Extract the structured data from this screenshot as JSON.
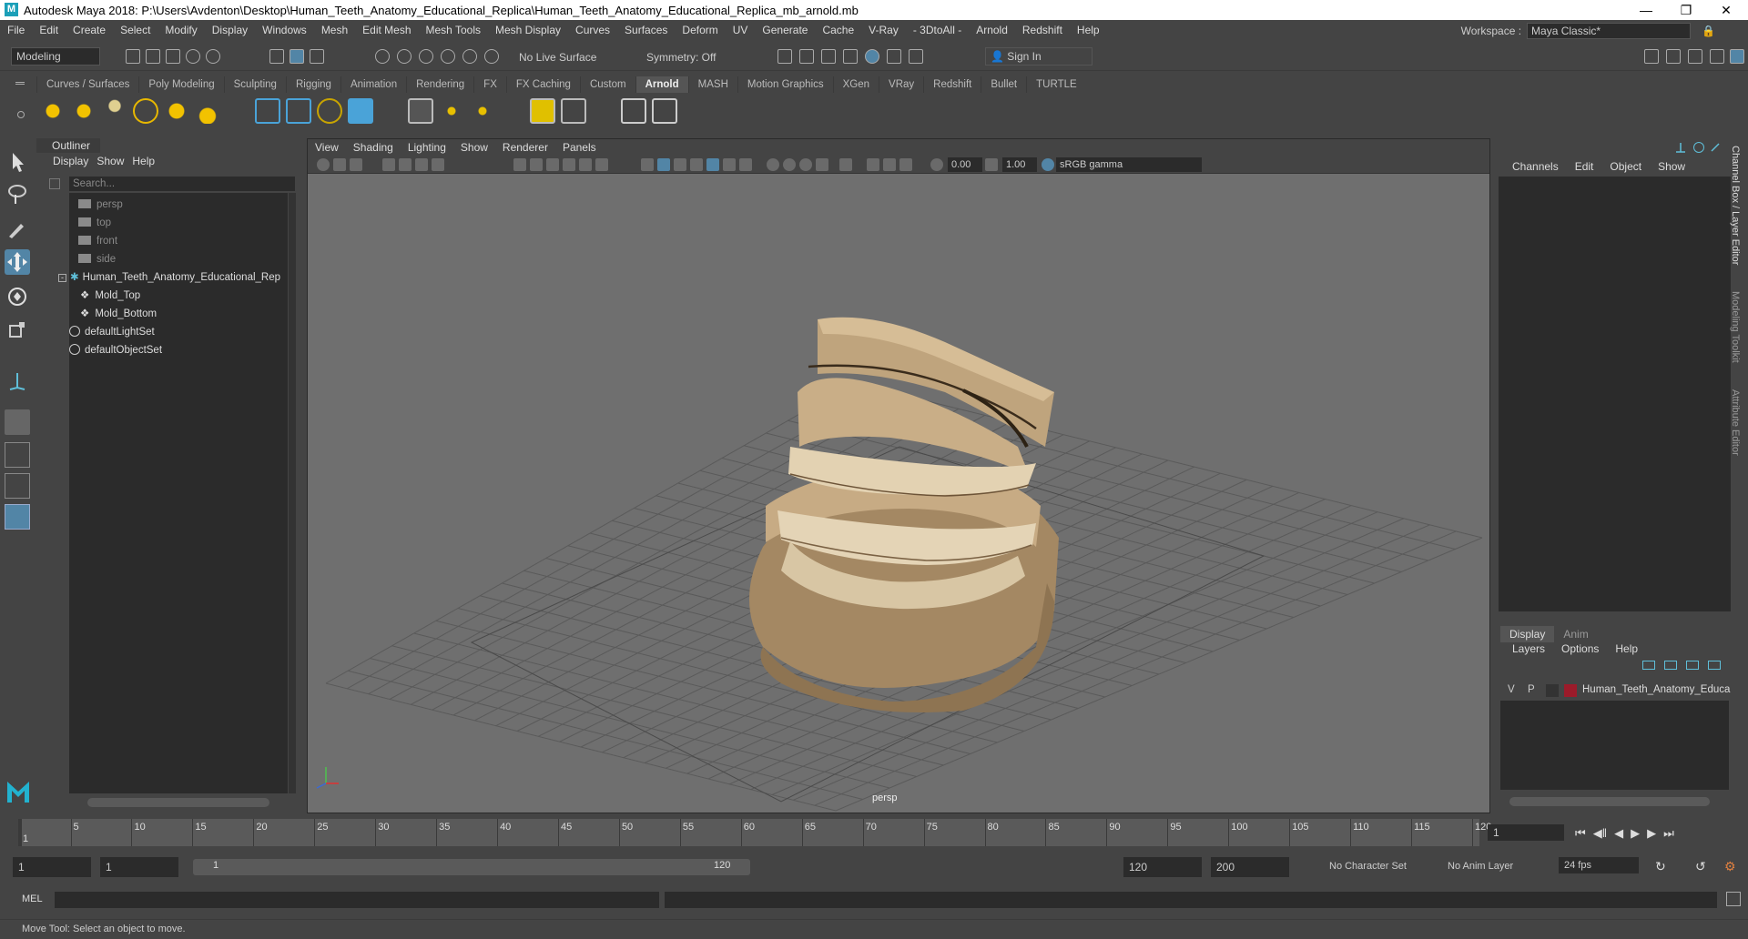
{
  "app": {
    "title": "Autodesk Maya 2018: P:\\Users\\Avdenton\\Desktop\\Human_Teeth_Anatomy_Educational_Replica\\Human_Teeth_Anatomy_Educational_Replica_mb_arnold.mb",
    "logo": "M"
  },
  "menus": [
    "File",
    "Edit",
    "Create",
    "Select",
    "Modify",
    "Display",
    "Windows",
    "Mesh",
    "Edit Mesh",
    "Mesh Tools",
    "Mesh Display",
    "Curves",
    "Surfaces",
    "Deform",
    "UV",
    "Generate",
    "Cache",
    "V-Ray",
    "- 3DtoAll -",
    "Arnold",
    "Redshift",
    "Help"
  ],
  "workspace": {
    "label": "Workspace :",
    "value": "Maya Classic*"
  },
  "status": {
    "mode": "Modeling",
    "live_surface": "No Live Surface",
    "symmetry": "Symmetry: Off",
    "sign_in": "Sign In"
  },
  "shelf_tabs": [
    "Curves / Surfaces",
    "Poly Modeling",
    "Sculpting",
    "Rigging",
    "Animation",
    "Rendering",
    "FX",
    "FX Caching",
    "Custom",
    "Arnold",
    "MASH",
    "Motion Graphics",
    "XGen",
    "VRay",
    "Redshift",
    "Bullet",
    "TURTLE"
  ],
  "shelf_active": "Arnold",
  "outliner": {
    "title": "Outliner",
    "menu": [
      "Display",
      "Show",
      "Help"
    ],
    "search_placeholder": "Search...",
    "items": [
      {
        "label": "persp",
        "dim": true,
        "icon": "camera-icon"
      },
      {
        "label": "top",
        "dim": true,
        "icon": "camera-icon"
      },
      {
        "label": "front",
        "dim": true,
        "icon": "camera-icon"
      },
      {
        "label": "side",
        "dim": true,
        "icon": "camera-icon"
      },
      {
        "label": "Human_Teeth_Anatomy_Educational_Rep",
        "dim": false,
        "icon": "group-icon"
      },
      {
        "label": "Mold_Top",
        "dim": false,
        "icon": "mesh-icon"
      },
      {
        "label": "Mold_Bottom",
        "dim": false,
        "icon": "mesh-icon"
      },
      {
        "label": "defaultLightSet",
        "dim": false,
        "icon": "set-icon"
      },
      {
        "label": "defaultObjectSet",
        "dim": false,
        "icon": "set-icon"
      }
    ]
  },
  "viewport": {
    "menu": [
      "View",
      "Shading",
      "Lighting",
      "Show",
      "Renderer",
      "Panels"
    ],
    "exposure": "0.00",
    "gamma": "1.00",
    "color_space": "sRGB gamma",
    "camera_label": "persp"
  },
  "channel_box": {
    "menu": [
      "Channels",
      "Edit",
      "Object",
      "Show"
    ],
    "side_tabs": [
      "Channel Box / Layer Editor",
      "Modeling Toolkit",
      "Attribute Editor"
    ]
  },
  "layers": {
    "tabs": [
      "Display",
      "Anim"
    ],
    "menu": [
      "Layers",
      "Options",
      "Help"
    ],
    "row": {
      "v": "V",
      "p": "P",
      "name": "Human_Teeth_Anatomy_Educa",
      "color": "#9b1b2a"
    }
  },
  "timeline": {
    "ticks": [
      "5",
      "10",
      "15",
      "20",
      "25",
      "30",
      "35",
      "40",
      "45",
      "50",
      "55",
      "60",
      "65",
      "70",
      "75",
      "80",
      "85",
      "90",
      "95",
      "100",
      "105",
      "110",
      "115",
      "120"
    ],
    "first": "1",
    "current": "1"
  },
  "range": {
    "start": "1",
    "playback_start": "1",
    "slider_start": "1",
    "slider_end": "120",
    "playback_end": "120",
    "end": "200",
    "character_set": "No Character Set",
    "anim_layer": "No Anim Layer",
    "fps": "24 fps"
  },
  "command": {
    "label": "MEL"
  },
  "help_line": "Move Tool: Select an object to move.",
  "colors": {
    "accent": "#5285a6",
    "model": "#b59a76"
  }
}
